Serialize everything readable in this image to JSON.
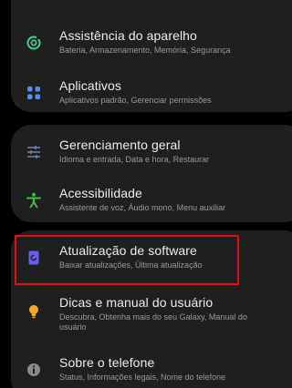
{
  "settings": {
    "items": [
      {
        "title": "Assistência do aparelho",
        "subtitle": "Bateria, Armazenamento, Memória, Segurança",
        "icon": "device-care-icon",
        "icon_color": "#3ecf8e"
      },
      {
        "title": "Aplicativos",
        "subtitle": "Aplicativos padrão, Gerenciar permissões",
        "icon": "apps-icon",
        "icon_color": "#5b8cf5"
      },
      {
        "title": "Gerenciamento geral",
        "subtitle": "Idioma e entrada, Data e hora, Restaurar",
        "icon": "general-management-icon",
        "icon_color": "#6b7fa8"
      },
      {
        "title": "Acessibilidade",
        "subtitle": "Assistente de voz, Áudio mono, Menu auxiliar",
        "icon": "accessibility-icon",
        "icon_color": "#3fbf3f"
      },
      {
        "title": "Atualização de software",
        "subtitle": "Baixar atualizações, Última atualização",
        "icon": "software-update-icon",
        "icon_color": "#6a5cf0"
      },
      {
        "title": "Dicas e manual do usuário",
        "subtitle": "Descubra, Obtenha mais do seu Galaxy, Manual do usuário",
        "icon": "tips-lightbulb-icon",
        "icon_color": "#f5a623"
      },
      {
        "title": "Sobre o telefone",
        "subtitle": "Status, Informações legais, Nome do telefone",
        "icon": "info-icon",
        "icon_color": "#8a8a8a"
      }
    ]
  },
  "colors": {
    "background": "#000000",
    "card": "#1f1f1f",
    "highlight": "#e0101a"
  }
}
